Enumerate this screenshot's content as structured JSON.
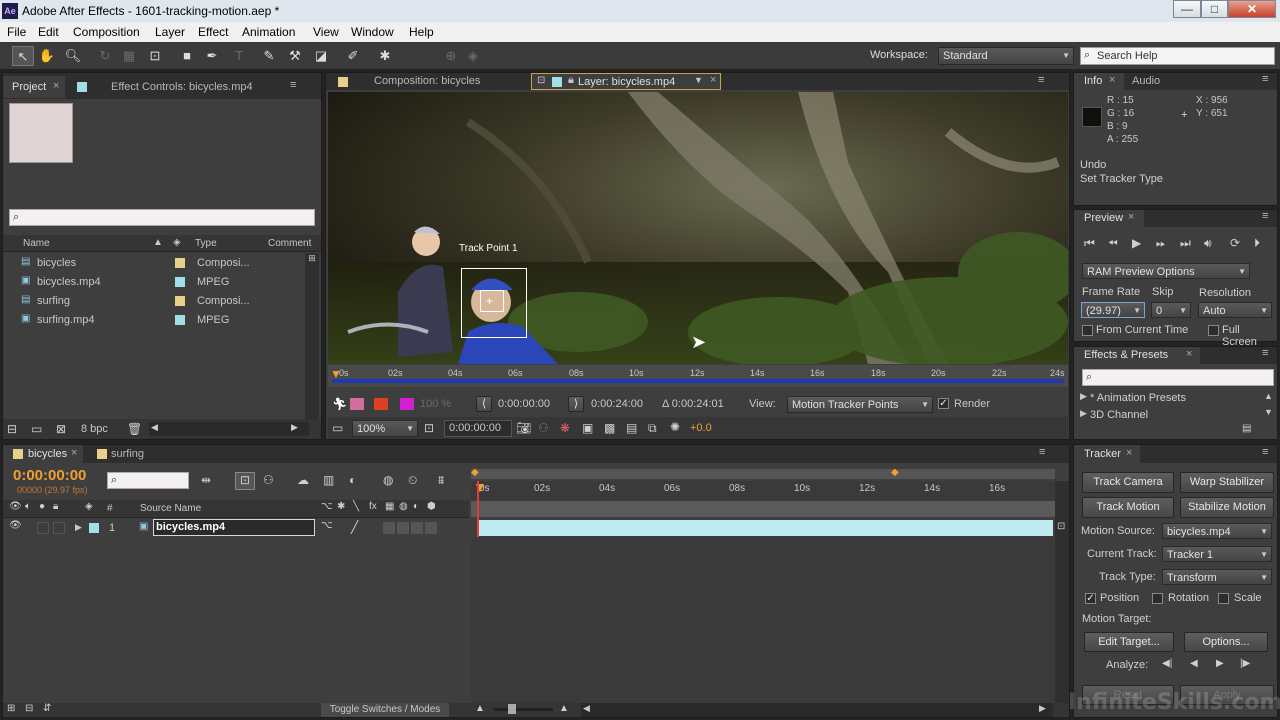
{
  "window": {
    "app_icon": "Ae",
    "title": "Adobe After Effects - 1601-tracking-motion.aep *",
    "minimize": "—",
    "maximize": "□",
    "close": "✕"
  },
  "menu": [
    "File",
    "Edit",
    "Composition",
    "Layer",
    "Effect",
    "Animation",
    "View",
    "Window",
    "Help"
  ],
  "toolbar": {
    "workspace_label": "Workspace:",
    "workspace_value": "Standard",
    "search_placeholder": "Search Help"
  },
  "project": {
    "tab_project": "Project",
    "tab_effect_controls": "Effect Controls: bicycles.mp4",
    "search_value": "",
    "columns": {
      "name": "Name",
      "type": "Type",
      "comment": "Comment"
    },
    "items": [
      {
        "name": "bicycles",
        "type": "Composi...",
        "color": "#e8d08a"
      },
      {
        "name": "bicycles.mp4",
        "type": "MPEG",
        "color": "#9fe0e8"
      },
      {
        "name": "surfing",
        "type": "Composi...",
        "color": "#e8d08a"
      },
      {
        "name": "surfing.mp4",
        "type": "MPEG",
        "color": "#9fe0e8"
      }
    ],
    "bpc": "8 bpc"
  },
  "viewer": {
    "tab_comp": "Composition: bicycles",
    "tab_layer": "Layer: bicycles.mp4",
    "track_point_label": "Track Point 1",
    "ruler": [
      "0s",
      "02s",
      "04s",
      "06s",
      "08s",
      "10s",
      "12s",
      "14s",
      "16s",
      "18s",
      "20s",
      "22s",
      "24s"
    ],
    "timecode_in": "0:00:00:00",
    "timecode_out": "0:00:24:00",
    "duration": "Δ 0:00:24:01",
    "view_label": "View:",
    "view_value": "Motion Tracker Points",
    "render_label": "Render",
    "opacity": "100 %",
    "zoom": "100%",
    "current_time": "0:00:00:00",
    "exposure": "+0.0"
  },
  "info": {
    "tab_info": "Info",
    "tab_audio": "Audio",
    "r": "R : 15",
    "g": "G : 16",
    "b": "B : 9",
    "a": "A : 255",
    "x": "X : 956",
    "y": "Y : 651",
    "undo": "Undo",
    "undo_action": "Set Tracker Type"
  },
  "preview": {
    "tab": "Preview",
    "ram_options": "RAM Preview Options",
    "frame_rate_label": "Frame Rate",
    "skip_label": "Skip",
    "resolution_label": "Resolution",
    "frame_rate": "(29.97)",
    "skip": "0",
    "resolution": "Auto",
    "from_current": "From Current Time",
    "full_screen": "Full Screen"
  },
  "effects": {
    "tab": "Effects & Presets",
    "search_value": "",
    "items": [
      "* Animation Presets",
      "3D Channel"
    ]
  },
  "timeline": {
    "tab_bicycles": "bicycles",
    "tab_surfing": "surfing",
    "timecode": "0:00:00:00",
    "fps": "00000 (29.97 fps)",
    "source_name_header": "Source Name",
    "hash_header": "#",
    "layer_number": "1",
    "layer_name": "bicycles.mp4",
    "ruler": [
      "0s",
      "02s",
      "04s",
      "06s",
      "08s",
      "10s",
      "12s",
      "14s",
      "16s"
    ],
    "toggle": "Toggle Switches / Modes"
  },
  "tracker": {
    "tab": "Tracker",
    "track_camera": "Track Camera",
    "warp_stabilizer": "Warp Stabilizer",
    "track_motion": "Track Motion",
    "stabilize_motion": "Stabilize Motion",
    "motion_source_label": "Motion Source:",
    "motion_source": "bicycles.mp4",
    "current_track_label": "Current Track:",
    "current_track": "Tracker 1",
    "track_type_label": "Track Type:",
    "track_type": "Transform",
    "position": "Position",
    "rotation": "Rotation",
    "scale": "Scale",
    "motion_target_label": "Motion Target:",
    "edit_target": "Edit Target...",
    "options": "Options...",
    "analyze_label": "Analyze:",
    "reset": "Reset",
    "apply": "Apply"
  },
  "watermark": "InfiniteSkills.com",
  "colors": {
    "accent_orange": "#f0a030",
    "accent_blue": "#5aa0ff",
    "layer_bar": "#bfeaf0",
    "playhead": "#e03c3c"
  }
}
